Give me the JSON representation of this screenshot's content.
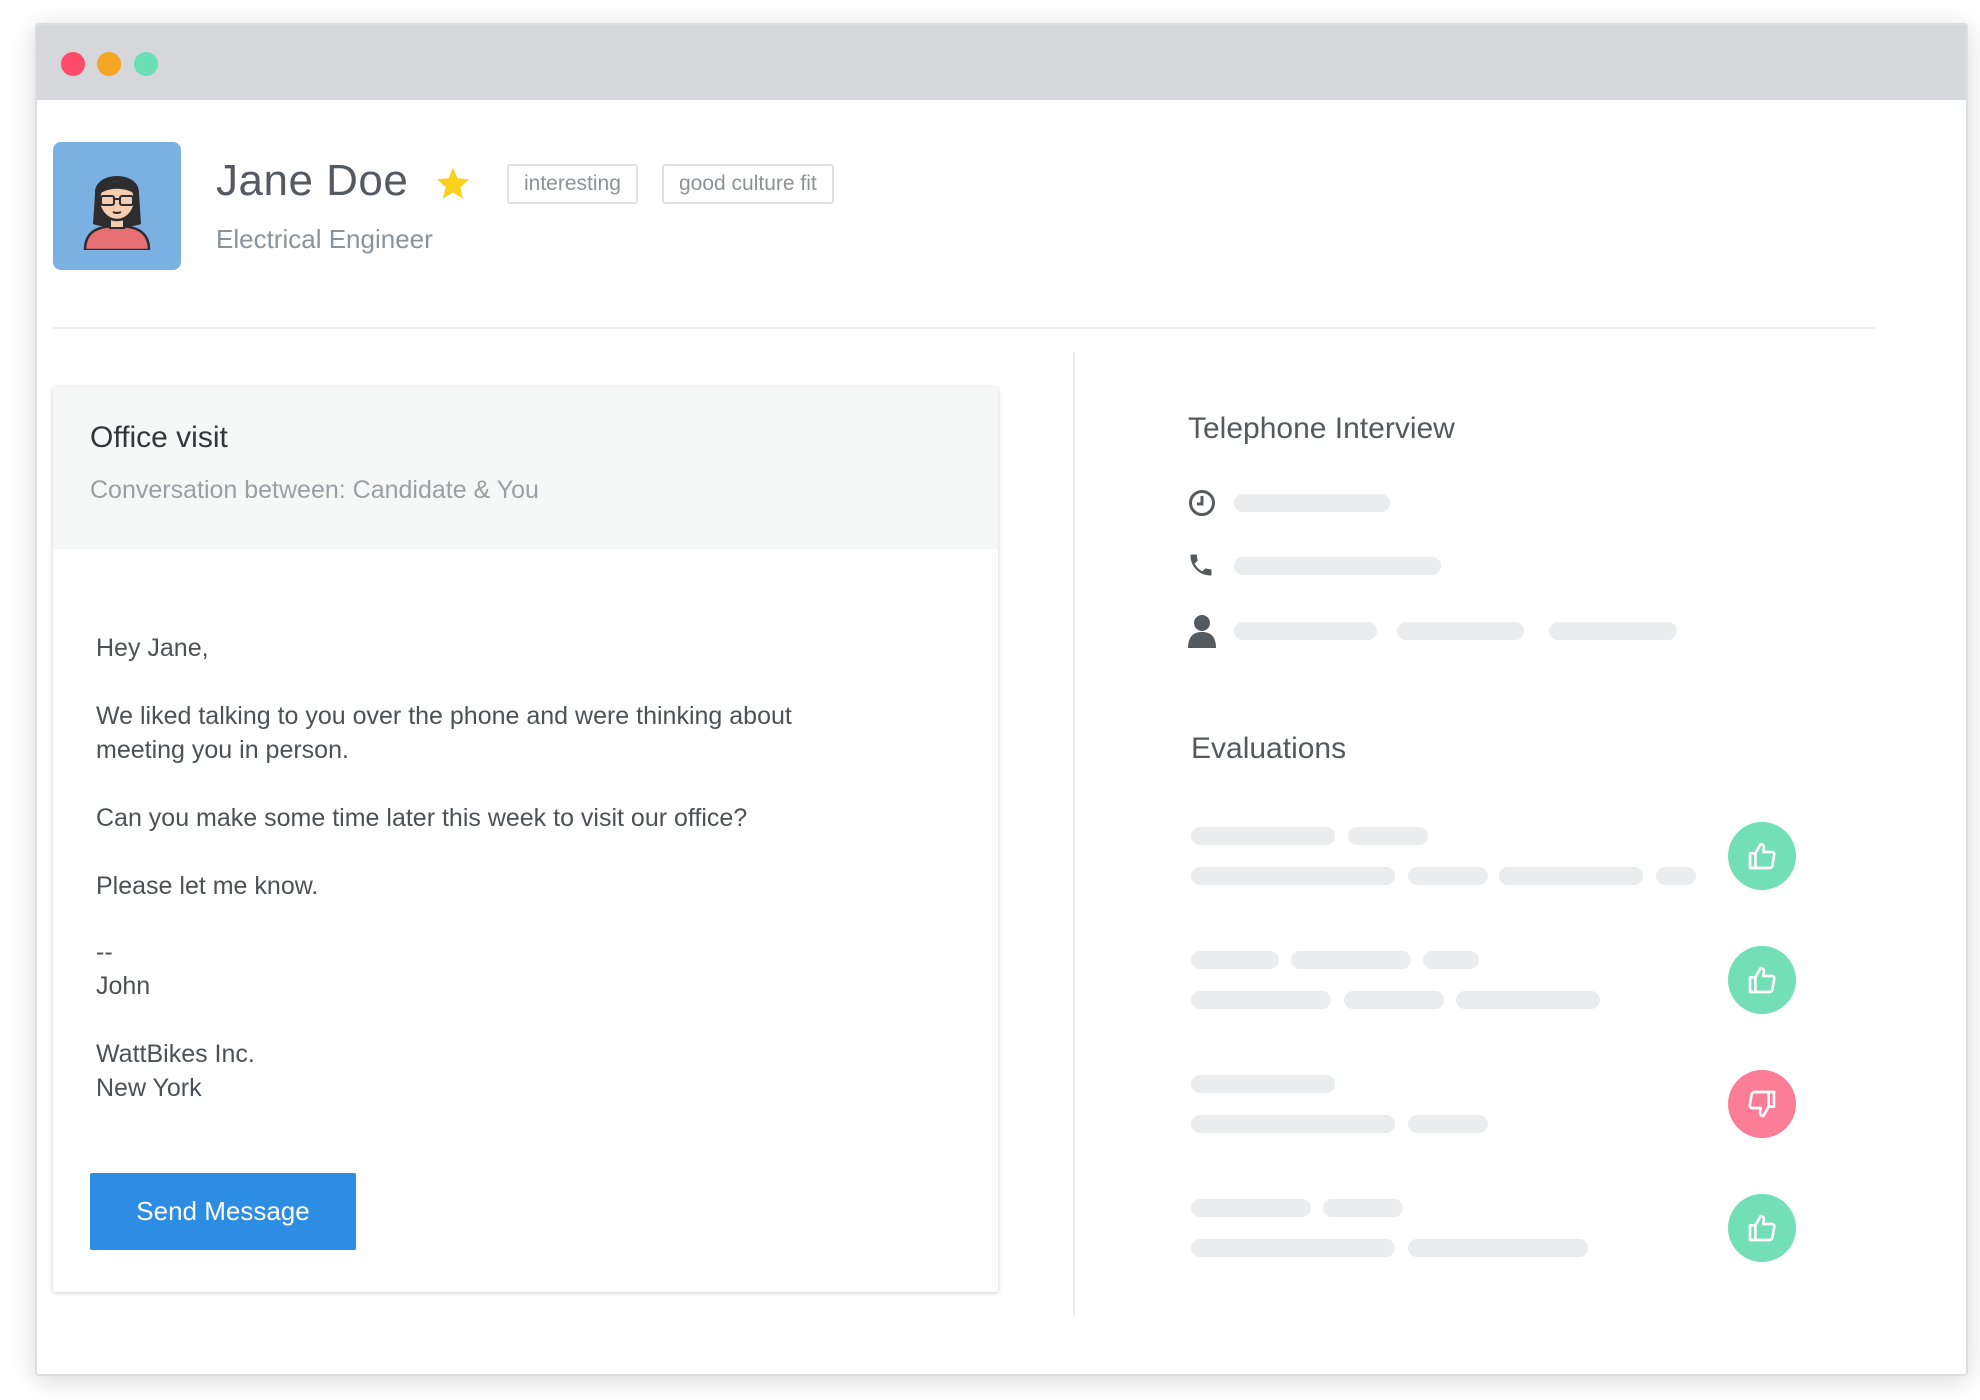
{
  "candidate": {
    "name": "Jane Doe",
    "title": "Electrical Engineer",
    "starred": true,
    "tags": [
      "interesting",
      "good culture fit"
    ]
  },
  "message_card": {
    "title": "Office visit",
    "subtitle": "Conversation between: Candidate & You",
    "body": [
      "Hey Jane,",
      "We liked talking to you over the phone and were thinking about",
      "meeting you in person.",
      "Can you make some time later this week to visit our office?",
      "Please let me know.",
      "--",
      "John",
      "WattBikes Inc.",
      "New York"
    ],
    "send_label": "Send Message",
    "send_color": "#2d8de3"
  },
  "telephone_interview": {
    "title": "Telephone Interview",
    "rows": [
      {
        "icon": "clock-icon"
      },
      {
        "icon": "phone-icon"
      },
      {
        "icon": "person-icon"
      }
    ]
  },
  "evaluations": {
    "title": "Evaluations",
    "items": [
      {
        "verdict": "thumbs-up",
        "color": "#72dfb7"
      },
      {
        "verdict": "thumbs-up",
        "color": "#72dfb7"
      },
      {
        "verdict": "thumbs-down",
        "color": "#fa7c95"
      },
      {
        "verdict": "thumbs-up",
        "color": "#72dfb7"
      }
    ]
  },
  "window_controls": {
    "close_color": "#fc4a6b",
    "minimize_color": "#f5a623",
    "zoom_color": "#6be0b6"
  }
}
